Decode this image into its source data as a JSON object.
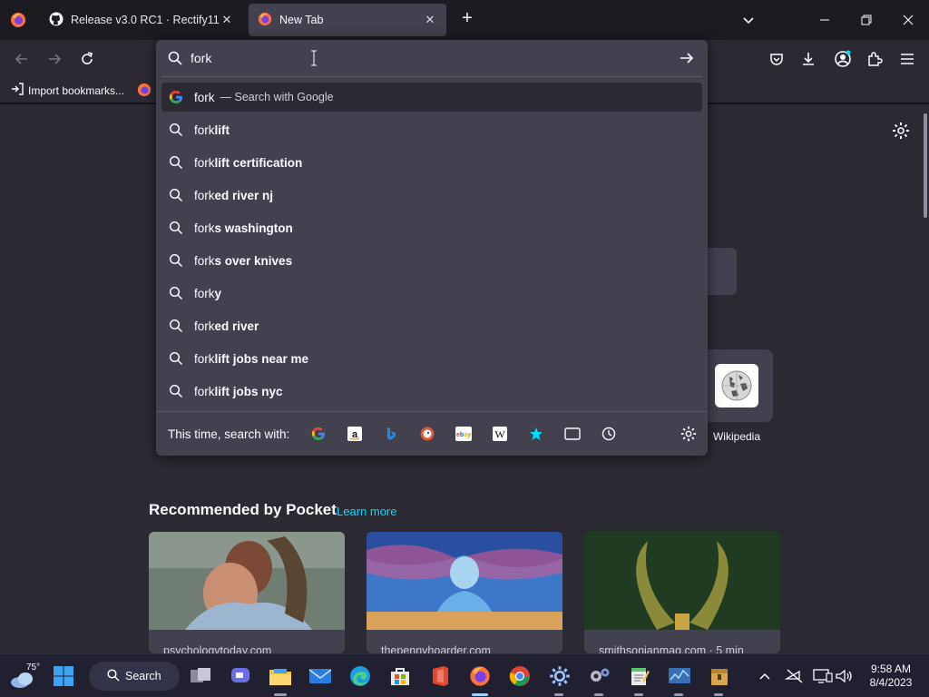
{
  "tabs": [
    {
      "title": "Release v3.0 RC1 · Rectify11/Inst",
      "icon": "github-icon"
    },
    {
      "title": "New Tab",
      "icon": "firefox-icon"
    }
  ],
  "bookmarks": {
    "import_label": "Import bookmarks..."
  },
  "urlbar": {
    "value": "fork"
  },
  "suggestions": [
    {
      "typed": "fork",
      "bold": "",
      "action": "— Search with Google",
      "icon": "google-icon",
      "selected": true
    },
    {
      "typed": "fork",
      "bold": "lift",
      "icon": "search-icon"
    },
    {
      "typed": "fork",
      "bold": "lift certification",
      "icon": "search-icon"
    },
    {
      "typed": "fork",
      "bold": "ed river nj",
      "icon": "search-icon"
    },
    {
      "typed": "fork",
      "bold": "s washington",
      "icon": "search-icon"
    },
    {
      "typed": "fork",
      "bold": "s over knives",
      "icon": "search-icon"
    },
    {
      "typed": "fork",
      "bold": "y",
      "icon": "search-icon"
    },
    {
      "typed": "fork",
      "bold": "ed river",
      "icon": "search-icon"
    },
    {
      "typed": "fork",
      "bold": "lift jobs near me",
      "icon": "search-icon"
    },
    {
      "typed": "fork",
      "bold": "lift jobs nyc",
      "icon": "search-icon"
    }
  ],
  "oneoff": {
    "label": "This time, search with:",
    "engines": [
      "google-icon",
      "amazon-icon",
      "bing-icon",
      "duckduckgo-icon",
      "ebay-icon",
      "wikipedia-icon",
      "bookmarks-star-icon",
      "tabs-icon",
      "history-icon"
    ]
  },
  "newtab": {
    "shortcut_label": "Wikipedia",
    "pocket_title": "Recommended by Pocket",
    "pocket_learn": "Learn more",
    "cards": [
      {
        "source": "psychologytoday.com"
      },
      {
        "source": "thepennyhoarder.com"
      },
      {
        "source": "smithsonianmag.com · 5 min"
      }
    ]
  },
  "taskbar": {
    "weather_temp": "75°",
    "search_label": "Search",
    "time": "9:58 AM",
    "date": "8/4/2023"
  },
  "colors": {
    "accent": "#00ddff",
    "toolbar": "#2b2a33",
    "popup": "#42414d"
  }
}
